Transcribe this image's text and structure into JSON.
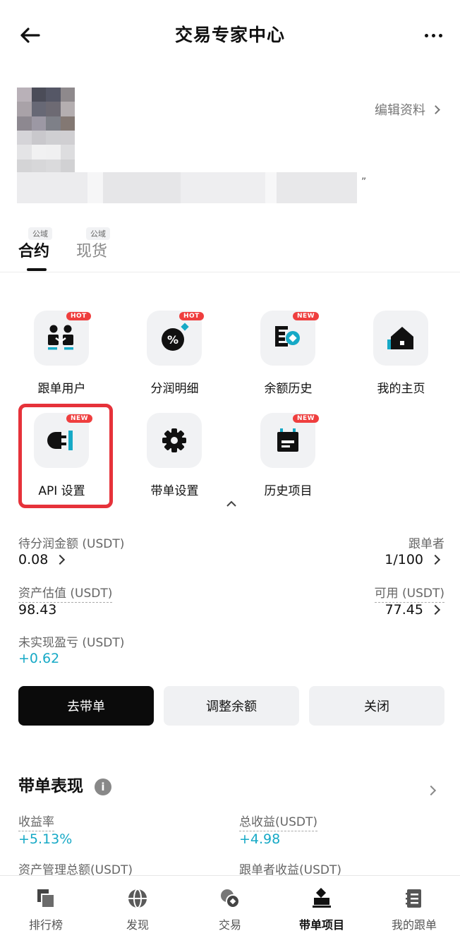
{
  "header": {
    "title": "交易专家中心"
  },
  "profile": {
    "edit_label": "编辑资料",
    "bio_end": "”"
  },
  "tabs": [
    {
      "label": "合约",
      "badge": "公域"
    },
    {
      "label": "现货",
      "badge": "公域"
    }
  ],
  "features": [
    {
      "label": "跟单用户",
      "badge": "HOT",
      "icon": "two-users-icon"
    },
    {
      "label": "分润明细",
      "badge": "HOT",
      "icon": "percent-icon"
    },
    {
      "label": "余额历史",
      "badge": "NEW",
      "icon": "balance-history-icon"
    },
    {
      "label": "我的主页",
      "badge": "",
      "icon": "home-icon"
    },
    {
      "label": "API 设置",
      "badge": "NEW",
      "icon": "plug-icon"
    },
    {
      "label": "带单设置",
      "badge": "",
      "icon": "gear-icon"
    },
    {
      "label": "历史项目",
      "badge": "NEW",
      "icon": "calendar-icon"
    }
  ],
  "stats": {
    "pending_label": "待分润金额 (USDT)",
    "pending_value": "0.08",
    "followers_label": "跟单者",
    "followers_value": "1/100",
    "assets_label": "资产估值 (USDT)",
    "assets_value": "98.43",
    "available_label": "可用 (USDT)",
    "available_value": "77.45",
    "unrealized_label": "未实现盈亏 (USDT)",
    "unrealized_value": "+0.62"
  },
  "actions": {
    "lead_label": "去带单",
    "adjust_label": "调整余额",
    "close_label": "关闭"
  },
  "performance": {
    "title": "带单表现",
    "return_label": "收益率",
    "return_value": "+5.13%",
    "total_label": "总收益(USDT)",
    "total_value": "+4.98",
    "aum_label": "资产管理总额(USDT)",
    "follower_profit_label": "跟单者收益(USDT)"
  },
  "bottom_nav": [
    {
      "label": "排行榜",
      "icon": "leaderboard-icon"
    },
    {
      "label": "发现",
      "icon": "globe-icon"
    },
    {
      "label": "交易",
      "icon": "trade-icon"
    },
    {
      "label": "带单项目",
      "icon": "lead-project-icon",
      "active": true
    },
    {
      "label": "我的跟单",
      "icon": "notebook-icon"
    }
  ],
  "colors": {
    "accent": "#16a9c6",
    "badge_red": "#ef3e3e",
    "highlight_red": "#e6323a"
  }
}
